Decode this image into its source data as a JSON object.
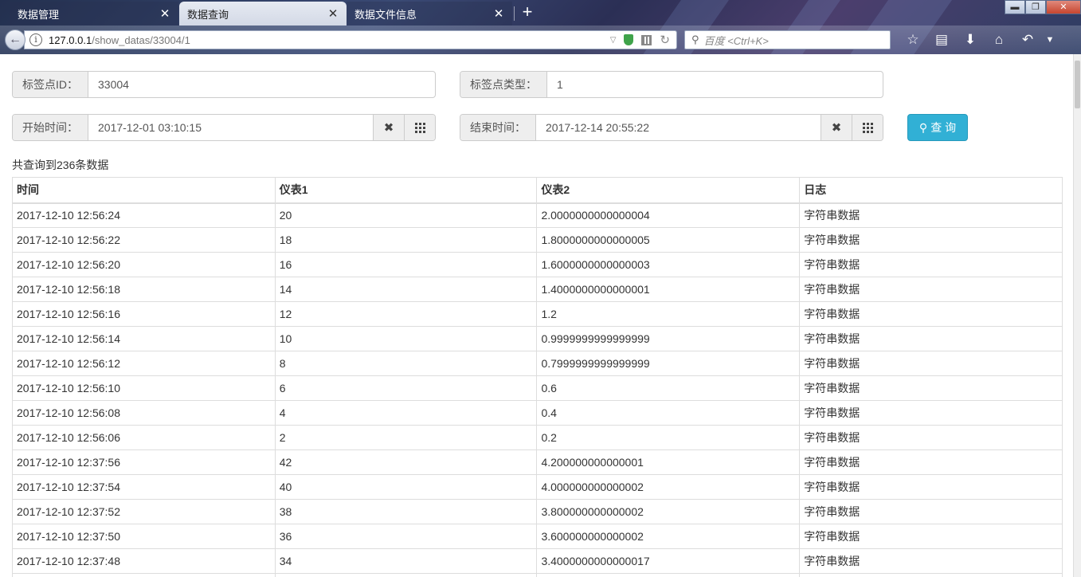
{
  "browser": {
    "tabs": [
      {
        "label": "数据管理",
        "active": false
      },
      {
        "label": "数据查询",
        "active": true
      },
      {
        "label": "数据文件信息",
        "active": false
      }
    ],
    "url_host": "127.0.0.1",
    "url_path": "/show_datas/33004/1",
    "search_placeholder": "百度 <Ctrl+K>"
  },
  "form": {
    "tag_id_label": "标签点ID：",
    "tag_id_value": "33004",
    "tag_type_label": "标签点类型：",
    "tag_type_value": "1",
    "start_label": "开始时间：",
    "start_value": "2017-12-01 03:10:15",
    "end_label": "结束时间：",
    "end_value": "2017-12-14 20:55:22",
    "query_label": "查 询"
  },
  "result_count": "共查询到236条数据",
  "table": {
    "headers": [
      "时间",
      "仪表1",
      "仪表2",
      "日志"
    ],
    "rows": [
      [
        "2017-12-10 12:56:24",
        "20",
        "2.0000000000000004",
        "字符串数据"
      ],
      [
        "2017-12-10 12:56:22",
        "18",
        "1.8000000000000005",
        "字符串数据"
      ],
      [
        "2017-12-10 12:56:20",
        "16",
        "1.6000000000000003",
        "字符串数据"
      ],
      [
        "2017-12-10 12:56:18",
        "14",
        "1.4000000000000001",
        "字符串数据"
      ],
      [
        "2017-12-10 12:56:16",
        "12",
        "1.2",
        "字符串数据"
      ],
      [
        "2017-12-10 12:56:14",
        "10",
        "0.9999999999999999",
        "字符串数据"
      ],
      [
        "2017-12-10 12:56:12",
        "8",
        "0.7999999999999999",
        "字符串数据"
      ],
      [
        "2017-12-10 12:56:10",
        "6",
        "0.6",
        "字符串数据"
      ],
      [
        "2017-12-10 12:56:08",
        "4",
        "0.4",
        "字符串数据"
      ],
      [
        "2017-12-10 12:56:06",
        "2",
        "0.2",
        "字符串数据"
      ],
      [
        "2017-12-10 12:37:56",
        "42",
        "4.200000000000001",
        "字符串数据"
      ],
      [
        "2017-12-10 12:37:54",
        "40",
        "4.000000000000002",
        "字符串数据"
      ],
      [
        "2017-12-10 12:37:52",
        "38",
        "3.800000000000002",
        "字符串数据"
      ],
      [
        "2017-12-10 12:37:50",
        "36",
        "3.600000000000002",
        "字符串数据"
      ],
      [
        "2017-12-10 12:37:48",
        "34",
        "3.4000000000000017",
        "字符串数据"
      ],
      [
        "",
        "",
        "",
        ""
      ]
    ]
  }
}
